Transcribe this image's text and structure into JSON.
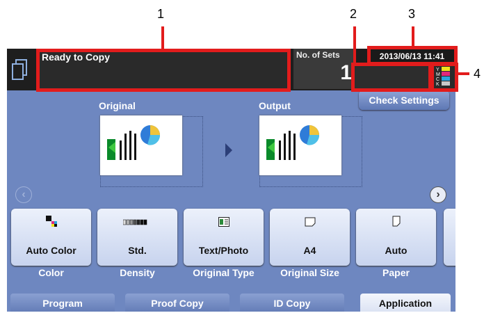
{
  "callouts": [
    "1",
    "2",
    "3",
    "4"
  ],
  "status": {
    "message": "Ready to Copy"
  },
  "sets": {
    "label": "No. of Sets",
    "value": "1"
  },
  "datetime": "2013/06/13 11:41",
  "toner_letters": [
    "Y",
    "M",
    "C",
    "K"
  ],
  "check_settings": "Check Settings",
  "preview": {
    "original_label": "Original",
    "output_label": "Output"
  },
  "functions": [
    {
      "value": "Auto Color",
      "label": "Color",
      "icon": "color-icon"
    },
    {
      "value": "Std.",
      "label": "Density",
      "icon": "density-icon"
    },
    {
      "value": "Text/Photo",
      "label": "Original Type",
      "icon": "original-type-icon"
    },
    {
      "value": "A4",
      "label": "Original Size",
      "icon": "original-size-icon"
    },
    {
      "value": "Auto",
      "label": "Paper",
      "icon": "paper-icon"
    }
  ],
  "tabs": [
    {
      "label": "Program"
    },
    {
      "label": "Proof Copy"
    },
    {
      "label": "ID Copy"
    },
    {
      "label": "Application",
      "active": true
    }
  ]
}
